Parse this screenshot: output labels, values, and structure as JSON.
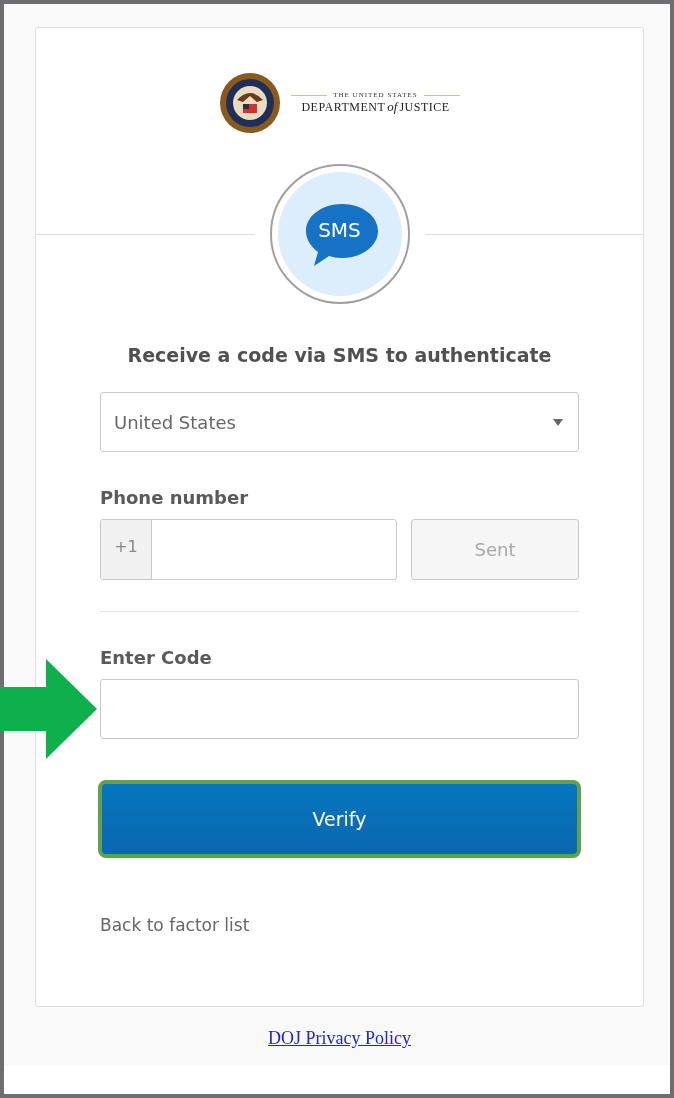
{
  "logo": {
    "tagline": "THE UNITED STATES",
    "name_start": "DEPARTMENT",
    "name_joiner": "of",
    "name_end": "JUSTICE"
  },
  "factor_badge": "SMS",
  "title": "Receive a code via SMS to authenticate",
  "country_select": {
    "value": "United States"
  },
  "phone": {
    "label": "Phone number",
    "prefix": "+1",
    "send_button": {
      "label": "Sent",
      "disabled": true
    }
  },
  "code": {
    "label": "Enter Code",
    "highlighted": true
  },
  "verify_button": {
    "label": "Verify",
    "highlighted": true
  },
  "back_link": "Back to factor list",
  "footer_link": "DOJ Privacy Policy"
}
